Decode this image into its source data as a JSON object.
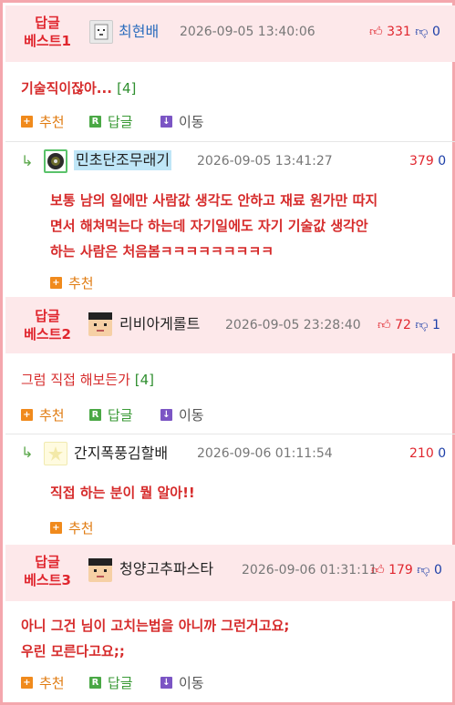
{
  "best": [
    {
      "tag_line1": "답글",
      "tag_line2": "베스트1",
      "author": "최현배",
      "date": "2026-09-05 13:40:06",
      "up": "331",
      "down": "0",
      "content": "기술직이잖아...",
      "reply_count": "[4]",
      "actions": {
        "recommend": "추천",
        "reply": "답글",
        "move": "이동"
      }
    },
    {
      "tag_line1": "답글",
      "tag_line2": "베스트2",
      "author": "리비아게롤트",
      "date": "2026-09-05 23:28:40",
      "up": "72",
      "down": "1",
      "content": "그럼 직접 해보든가",
      "reply_count": "[4]",
      "actions": {
        "recommend": "추천",
        "reply": "답글",
        "move": "이동"
      }
    },
    {
      "tag_line1": "답글",
      "tag_line2": "베스트3",
      "author": "청양고추파스타",
      "date": "2026-09-06 01:31:11",
      "up": "179",
      "down": "0",
      "content_line1": "아니 그건 님이 고치는법을 아니까 그런거고요;",
      "content_line2": "우린 모른다고요;;",
      "actions": {
        "recommend": "추천",
        "reply": "답글",
        "move": "이동"
      }
    }
  ],
  "replies": [
    {
      "author": "민초단조무래기",
      "date": "2026-09-05 13:41:27",
      "up": "379",
      "down": "0",
      "line1": "보통 남의 일에만 사람값 생각도 안하고 재료 원가만 따지",
      "line2": "면서 해쳐먹는다 하는데 자기일에도 자기 기술값 생각안",
      "line3": "하는 사람은 처음봄ㅋㅋㅋㅋㅋㅋㅋㅋㅋ",
      "recommend": "추천"
    },
    {
      "author": "간지폭풍김할배",
      "date": "2026-09-06 01:11:54",
      "up": "210",
      "down": "0",
      "line1": "직접 하는 분이 뭘 알아!!",
      "recommend": "추천"
    }
  ],
  "icons": {
    "plus": "+",
    "reply": "R",
    "move": "↓",
    "reply_arrow": "↳",
    "thumb_up": "👍",
    "thumb_down": "👎"
  }
}
